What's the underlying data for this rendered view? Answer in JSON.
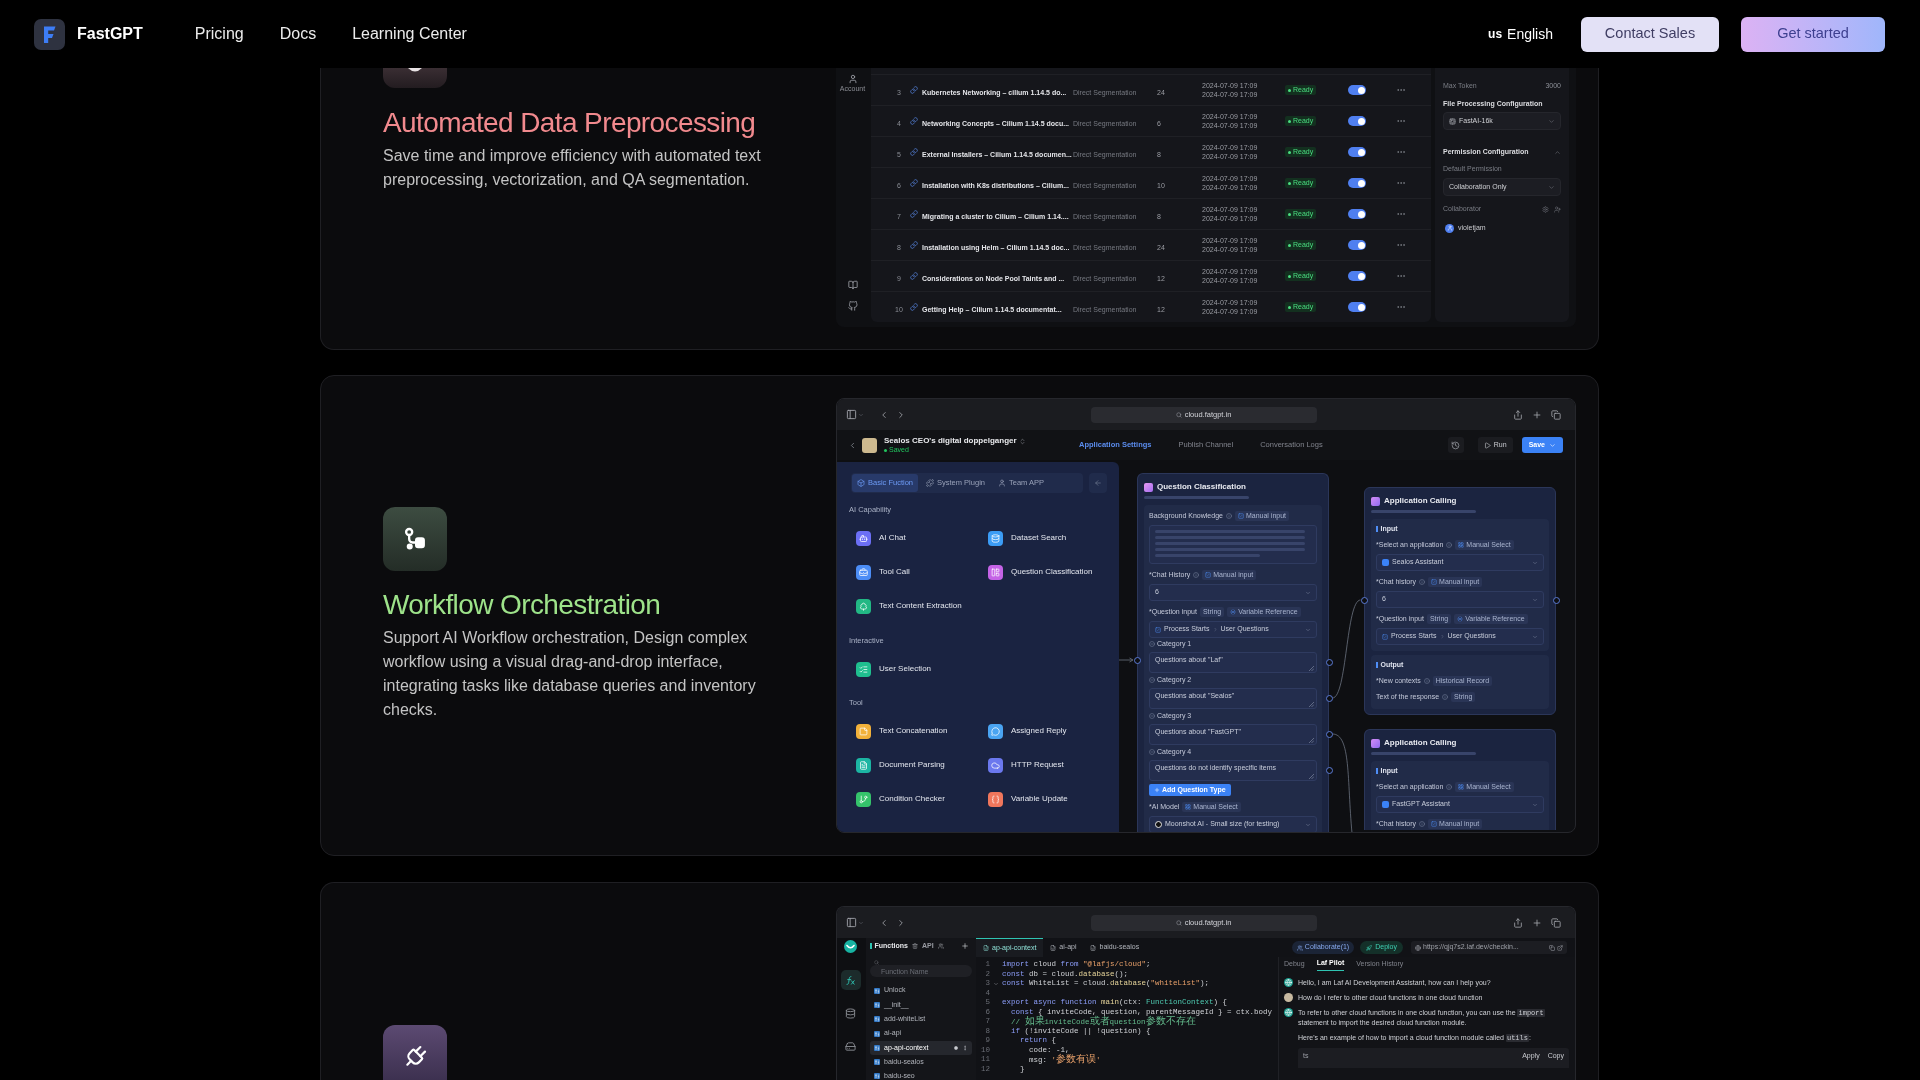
{
  "header": {
    "brand": "FastGPT",
    "nav": [
      {
        "label": "Pricing"
      },
      {
        "label": "Docs"
      },
      {
        "label": "Learning Center"
      }
    ],
    "language": {
      "flag": "us",
      "label": "English"
    },
    "buttons": [
      {
        "kind": "secondary",
        "label": "Contact Sales"
      },
      {
        "kind": "primary",
        "label": "Get started"
      }
    ]
  },
  "features": [
    {
      "kind": "dataset",
      "title": "Automated Data Preprocessing",
      "color": "#f28a8e",
      "description": "Save time and improve efficiency with automated text preprocessing, vectorization, and QA segmentation.",
      "screen": {
        "sidebar": {
          "account": "Account"
        },
        "rows": [
          {
            "index": "3",
            "name": "Kubernetes Networking – cilium 1.14.5 do...",
            "mode": "Direct Segmentation",
            "count": "24",
            "created": "2024-07-09 17:09",
            "updated": "2024-07-09 17:09",
            "status": "Ready",
            "enabled": true
          },
          {
            "index": "4",
            "name": "Networking Concepts – Cilium 1.14.5 docu...",
            "mode": "Direct Segmentation",
            "count": "6",
            "created": "2024-07-09 17:09",
            "updated": "2024-07-09 17:09",
            "status": "Ready",
            "enabled": true
          },
          {
            "index": "5",
            "name": "External Installers – Cilium 1.14.5 documen...",
            "mode": "Direct Segmentation",
            "count": "8",
            "created": "2024-07-09 17:09",
            "updated": "2024-07-09 17:09",
            "status": "Ready",
            "enabled": true
          },
          {
            "index": "6",
            "name": "Installation with K8s distributions – Cilium...",
            "mode": "Direct Segmentation",
            "count": "10",
            "created": "2024-07-09 17:09",
            "updated": "2024-07-09 17:09",
            "status": "Ready",
            "enabled": true
          },
          {
            "index": "7",
            "name": "Migrating a cluster to Cilium – Cilium 1.14....",
            "mode": "Direct Segmentation",
            "count": "8",
            "created": "2024-07-09 17:09",
            "updated": "2024-07-09 17:09",
            "status": "Ready",
            "enabled": true
          },
          {
            "index": "8",
            "name": "Installation using Helm – Cilium 1.14.5 doc...",
            "mode": "Direct Segmentation",
            "count": "24",
            "created": "2024-07-09 17:09",
            "updated": "2024-07-09 17:09",
            "status": "Ready",
            "enabled": true
          },
          {
            "index": "9",
            "name": "Considerations on Node Pool Taints and ...",
            "mode": "Direct Segmentation",
            "count": "12",
            "created": "2024-07-09 17:09",
            "updated": "2024-07-09 17:09",
            "status": "Ready",
            "enabled": true
          },
          {
            "index": "10",
            "name": "Getting Help – Cilium 1.14.5 documentat...",
            "mode": "Direct Segmentation",
            "count": "12",
            "created": "2024-07-09 17:09",
            "updated": "2024-07-09 17:09",
            "status": "Ready",
            "enabled": true
          }
        ],
        "settings": {
          "max_token": {
            "label": "Max Token",
            "value": "3000"
          },
          "file_processing": {
            "title": "File Processing Configuration",
            "value": "FastAI-16k"
          },
          "permission": {
            "title": "Permission Configuration",
            "expanded": true,
            "default_label": "Default Permission",
            "default_value": "Collaboration Only",
            "collaborator_label": "Collaborator",
            "collaborators": [
              {
                "name": "violetjam"
              }
            ]
          }
        }
      }
    },
    {
      "kind": "workflow",
      "title": "Workflow Orchestration",
      "color": "#9ee38a",
      "description": "Support AI Workflow orchestration, Design complex workflow using a visual drag-and-drop interface, integrating tasks like database queries and inventory checks.",
      "screen": {
        "url": "cloud.fatgpt.in",
        "app": {
          "name": "Sealos CEO's digital doppelganger",
          "status": "Saved",
          "tabs": [
            {
              "label": "Application Settings",
              "selected": true
            },
            {
              "label": "Publish Channel",
              "selected": false
            },
            {
              "label": "Conversation Logs",
              "selected": false
            }
          ],
          "run": "Run",
          "save": "Save"
        },
        "library": {
          "tabs": [
            {
              "label": "Basic Fuction",
              "selected": true
            },
            {
              "label": "System Plugin",
              "selected": false
            },
            {
              "label": "Team APP",
              "selected": false
            }
          ],
          "sections": [
            {
              "title": "AI Capability",
              "items": [
                {
                  "label": "AI Chat",
                  "color": "#6c6ff5"
                },
                {
                  "label": "Dataset Search",
                  "color": "#3b9cf5"
                },
                {
                  "label": "Tool Call",
                  "color": "#4c8df6"
                },
                {
                  "label": "Question Classification",
                  "color": "#c563e6"
                },
                {
                  "label": "Text Content Extraction",
                  "color": "#22b884"
                }
              ]
            },
            {
              "title": "Interactive",
              "items": [
                {
                  "label": "User Selection",
                  "color": "#1fbf8f"
                }
              ]
            },
            {
              "title": "Tool",
              "items": [
                {
                  "label": "Text Concatenation",
                  "color": "#f2b13a"
                },
                {
                  "label": "Assigned Reply",
                  "color": "#4aa4f2"
                },
                {
                  "label": "Document Parsing",
                  "color": "#1cb5a3"
                },
                {
                  "label": "HTTP Request",
                  "color": "#6b78ee"
                },
                {
                  "label": "Condition Checker",
                  "color": "#35c36b"
                },
                {
                  "label": "Variable Update",
                  "color": "#f0765c"
                }
              ]
            }
          ]
        },
        "nodes": [
          {
            "kind": "classifier",
            "title": "Question Classification",
            "sections": [
              {
                "items": [
                  {
                    "kind": "field",
                    "label": "Background Knowledge",
                    "info": true,
                    "tags": [
                      {
                        "kind": "input",
                        "label": "Manual input"
                      }
                    ]
                  },
                  {
                    "kind": "textarea"
                  },
                  {
                    "kind": "field",
                    "label": "*Chat History",
                    "info": true,
                    "tags": [
                      {
                        "kind": "input",
                        "label": "Manual input"
                      }
                    ]
                  },
                  {
                    "kind": "select",
                    "value": "6"
                  },
                  {
                    "kind": "field",
                    "label": "*Question input",
                    "info": false,
                    "tags": [
                      {
                        "kind": "type",
                        "label": "String"
                      },
                      {
                        "kind": "reference",
                        "label": "Variable Reference"
                      }
                    ]
                  },
                  {
                    "kind": "ref",
                    "source": "Process Starts",
                    "field": "User Questions"
                  },
                  {
                    "kind": "category",
                    "label": "Category 1",
                    "value": "Questions about \"Laf\""
                  },
                  {
                    "kind": "category",
                    "label": "Category 2",
                    "value": "Questions about \"Sealos\""
                  },
                  {
                    "kind": "category",
                    "label": "Category 3",
                    "value": "Questions about \"FastGPT\""
                  },
                  {
                    "kind": "category",
                    "label": "Category 4",
                    "value": "Questions do not identify specific items"
                  },
                  {
                    "kind": "button",
                    "label": "Add Question Type"
                  },
                  {
                    "kind": "field",
                    "label": "*AI Model",
                    "info": false,
                    "tags": [
                      {
                        "kind": "select",
                        "label": "Manual Select"
                      }
                    ]
                  },
                  {
                    "kind": "model",
                    "value": "Moonshot AI - Small size (for testing)"
                  }
                ]
              }
            ]
          },
          {
            "kind": "app_call",
            "title": "Application Calling",
            "sections": [
              {
                "title": "Input",
                "items": [
                  {
                    "kind": "field",
                    "label": "*Select an application",
                    "info": true,
                    "tags": [
                      {
                        "kind": "select",
                        "label": "Manual Select"
                      }
                    ]
                  },
                  {
                    "kind": "app",
                    "value": "Sealos Assistant"
                  },
                  {
                    "kind": "field",
                    "label": "*Chat history",
                    "info": true,
                    "tags": [
                      {
                        "kind": "input",
                        "label": "Manual input"
                      }
                    ]
                  },
                  {
                    "kind": "select",
                    "value": "6"
                  },
                  {
                    "kind": "field",
                    "label": "*Question input",
                    "info": false,
                    "tags": [
                      {
                        "kind": "type",
                        "label": "String"
                      },
                      {
                        "kind": "reference",
                        "label": "Variable Reference"
                      }
                    ]
                  },
                  {
                    "kind": "ref",
                    "source": "Process Starts",
                    "field": "User Questions"
                  }
                ]
              },
              {
                "title": "Output",
                "items": [
                  {
                    "kind": "field",
                    "label": "*New contexts",
                    "info": true,
                    "tags": [
                      {
                        "kind": "type",
                        "label": "Historical Record"
                      }
                    ]
                  },
                  {
                    "kind": "field",
                    "label": "Text of the response",
                    "info": true,
                    "tags": [
                      {
                        "kind": "type",
                        "label": "String"
                      }
                    ]
                  }
                ]
              }
            ]
          },
          {
            "kind": "app_call",
            "title": "Application Calling",
            "sections": [
              {
                "title": "Input",
                "items": [
                  {
                    "kind": "field",
                    "label": "*Select an application",
                    "info": true,
                    "tags": [
                      {
                        "kind": "select",
                        "label": "Manual Select"
                      }
                    ]
                  },
                  {
                    "kind": "app",
                    "value": "FastGPT Assistant"
                  },
                  {
                    "kind": "field",
                    "label": "*Chat history",
                    "info": true,
                    "tags": [
                      {
                        "kind": "input",
                        "label": "Manual input"
                      }
                    ]
                  }
                ]
              }
            ]
          }
        ]
      }
    },
    {
      "kind": "plugin",
      "screen": {
        "url": "cloud.fatgpt.in",
        "rail": [
          {
            "kind": "functions",
            "selected": true
          },
          {
            "kind": "collections",
            "selected": false
          },
          {
            "kind": "storage",
            "selected": false
          }
        ],
        "functions": {
          "title": "Functions",
          "api": "API",
          "placeholder": "Function Name",
          "items": [
            {
              "name": "Unlock",
              "selected": false
            },
            {
              "name": "__init__",
              "selected": false
            },
            {
              "name": "add-whiteList",
              "selected": false
            },
            {
              "name": "ai-api",
              "selected": false
            },
            {
              "name": "ap-api-context",
              "selected": true
            },
            {
              "name": "baidu-sealos",
              "selected": false
            },
            {
              "name": "baidu-seo",
              "selected": false
            }
          ]
        },
        "editor": {
          "tabs": [
            {
              "label": "ap-api-context",
              "selected": true
            },
            {
              "label": "ai-api",
              "selected": false
            },
            {
              "label": "baidu-sealos",
              "selected": false
            }
          ],
          "actions": {
            "collaborate": "Collaborate(1)",
            "deploy": "Deploy",
            "url": "https://qjq7s2.laf.dev/checkin..."
          },
          "lines": [
            {
              "number": "1",
              "fold": false,
              "tokens": [
                {
                  "kind": "keyword",
                  "text": "import"
                },
                {
                  "kind": "plain",
                  "text": " cloud "
                },
                {
                  "kind": "keyword",
                  "text": "from"
                },
                {
                  "kind": "string",
                  "text": " \"@lafjs/cloud\""
                },
                {
                  "kind": "plain",
                  "text": ";"
                }
              ]
            },
            {
              "number": "2",
              "fold": false,
              "tokens": [
                {
                  "kind": "keyword",
                  "text": "const"
                },
                {
                  "kind": "plain",
                  "text": " db = cloud."
                },
                {
                  "kind": "function",
                  "text": "database"
                },
                {
                  "kind": "plain",
                  "text": "();"
                }
              ]
            },
            {
              "number": "3",
              "fold": true,
              "tokens": [
                {
                  "kind": "keyword",
                  "text": "const"
                },
                {
                  "kind": "plain",
                  "text": " WhiteList = cloud."
                },
                {
                  "kind": "function",
                  "text": "database"
                },
                {
                  "kind": "plain",
                  "text": "("
                },
                {
                  "kind": "string",
                  "text": "\"whiteList\""
                },
                {
                  "kind": "plain",
                  "text": ");"
                }
              ]
            },
            {
              "number": "4",
              "fold": false
            },
            {
              "number": "5",
              "fold": false,
              "tokens": [
                {
                  "kind": "keyword",
                  "text": "export async function"
                },
                {
                  "kind": "function",
                  "text": " main"
                },
                {
                  "kind": "plain",
                  "text": "(ctx: "
                },
                {
                  "kind": "type",
                  "text": "FunctionContext"
                },
                {
                  "kind": "plain",
                  "text": ") {"
                }
              ]
            },
            {
              "number": "6",
              "fold": false,
              "tokens": [
                {
                  "kind": "keyword",
                  "text": "  const"
                },
                {
                  "kind": "plain",
                  "text": " { inviteCode, question, parentMessageId } = ctx.body"
                }
              ]
            },
            {
              "number": "7",
              "fold": false,
              "tokens": [
                {
                  "kind": "comment",
                  "text": "  // 如果inviteCode或者question参数不存在"
                }
              ]
            },
            {
              "number": "8",
              "fold": false,
              "tokens": [
                {
                  "kind": "keyword",
                  "text": "  if"
                },
                {
                  "kind": "plain",
                  "text": " (!inviteCode || !question) {"
                }
              ]
            },
            {
              "number": "9",
              "fold": false,
              "tokens": [
                {
                  "kind": "keyword",
                  "text": "    return"
                },
                {
                  "kind": "plain",
                  "text": " {"
                }
              ]
            },
            {
              "number": "10",
              "fold": false,
              "tokens": [
                {
                  "kind": "plain",
                  "text": "      code: -1,"
                }
              ]
            },
            {
              "number": "11",
              "fold": false,
              "tokens": [
                {
                  "kind": "plain",
                  "text": "      msg: "
                },
                {
                  "kind": "string",
                  "text": "'参数有误'"
                }
              ]
            },
            {
              "number": "12",
              "fold": false,
              "tokens": [
                {
                  "kind": "plain",
                  "text": "    }"
                }
              ]
            }
          ]
        },
        "assistant": {
          "tabs": [
            {
              "label": "Debug",
              "selected": false
            },
            {
              "label": "Laf Pilot",
              "selected": true
            },
            {
              "label": "Version History",
              "selected": false
            }
          ],
          "messages": [
            {
              "kind": "assistant",
              "paragraphs": [
                [
                  {
                    "text": "Hello, I am Laf AI Development Assistant, how can I help you?"
                  }
                ]
              ]
            },
            {
              "kind": "user",
              "paragraphs": [
                [
                  {
                    "text": "How do I refer to other cloud functions in one cloud function"
                  }
                ]
              ]
            },
            {
              "kind": "assistant",
              "paragraphs": [
                [
                  {
                    "text": "To refer to other cloud functions in one cloud function, you can use the "
                  },
                  {
                    "code": "import"
                  },
                  {
                    "text": " statement to import the desired cloud function module."
                  }
                ],
                [
                  {
                    "text": "Here's an example of how to import a cloud function module called "
                  },
                  {
                    "code": "utils"
                  },
                  {
                    "text": ":"
                  }
                ]
              ]
            }
          ],
          "code_block": {
            "language": "ts",
            "apply": "Apply",
            "copy": "Copy"
          }
        }
      }
    }
  ]
}
